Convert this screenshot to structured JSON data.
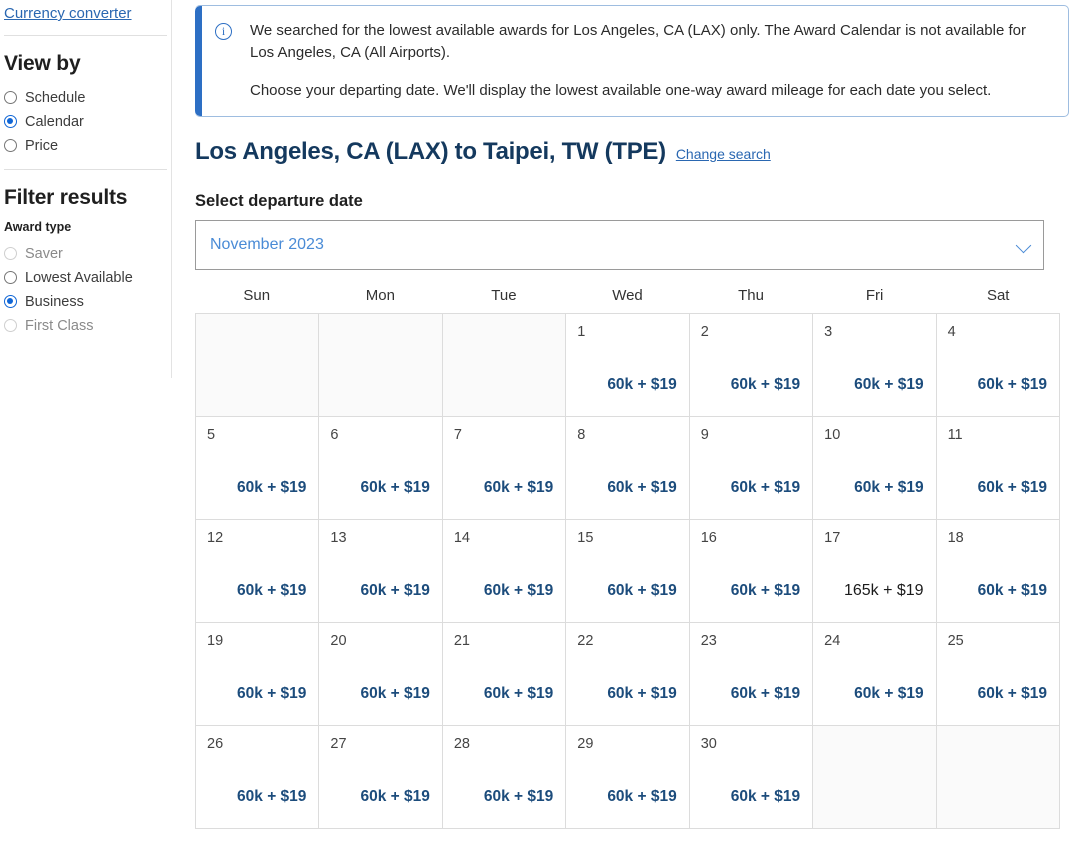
{
  "sidebar": {
    "currency_converter_label": "Currency converter",
    "view_by": {
      "heading": "View by",
      "options": [
        {
          "label": "Schedule",
          "checked": false,
          "disabled": false
        },
        {
          "label": "Calendar",
          "checked": true,
          "disabled": false
        },
        {
          "label": "Price",
          "checked": false,
          "disabled": false
        }
      ]
    },
    "filter_results": {
      "heading": "Filter results",
      "award_type_heading": "Award type",
      "options": [
        {
          "label": "Saver",
          "checked": false,
          "disabled": true
        },
        {
          "label": "Lowest Available",
          "checked": false,
          "disabled": false
        },
        {
          "label": "Business",
          "checked": true,
          "disabled": false
        },
        {
          "label": "First Class",
          "checked": false,
          "disabled": true
        }
      ]
    }
  },
  "banner": {
    "icon": "info-circle-icon",
    "paragraph_1": "We searched for the lowest available awards for Los Angeles, CA (LAX) only. The Award Calendar is not available for Los Angeles, CA (All Airports).",
    "paragraph_2": "Choose your departing date. We'll display the lowest available one-way award mileage for each date you select.",
    "accent_color": "#2d6fc4"
  },
  "route": {
    "title": "Los Angeles, CA (LAX) to Taipei, TW (TPE)",
    "change_search_label": "Change search",
    "title_color": "#14395e"
  },
  "departure": {
    "label": "Select departure date",
    "selected_month": "November 2023",
    "chevron_icon": "chevron-down-icon"
  },
  "calendar": {
    "weekdays": [
      "Sun",
      "Mon",
      "Tue",
      "Wed",
      "Thu",
      "Fri",
      "Sat"
    ],
    "available_color": "#1c4c7c",
    "selected_color": "#1b1b1b",
    "weeks": [
      [
        {
          "day": "",
          "price": ""
        },
        {
          "day": "",
          "price": ""
        },
        {
          "day": "",
          "price": ""
        },
        {
          "day": "1",
          "price": "60k + $19",
          "selected": false
        },
        {
          "day": "2",
          "price": "60k + $19",
          "selected": false
        },
        {
          "day": "3",
          "price": "60k + $19",
          "selected": false
        },
        {
          "day": "4",
          "price": "60k + $19",
          "selected": false
        }
      ],
      [
        {
          "day": "5",
          "price": "60k + $19",
          "selected": false
        },
        {
          "day": "6",
          "price": "60k + $19",
          "selected": false
        },
        {
          "day": "7",
          "price": "60k + $19",
          "selected": false
        },
        {
          "day": "8",
          "price": "60k + $19",
          "selected": false
        },
        {
          "day": "9",
          "price": "60k + $19",
          "selected": false
        },
        {
          "day": "10",
          "price": "60k + $19",
          "selected": false
        },
        {
          "day": "11",
          "price": "60k + $19",
          "selected": false
        }
      ],
      [
        {
          "day": "12",
          "price": "60k + $19",
          "selected": false
        },
        {
          "day": "13",
          "price": "60k + $19",
          "selected": false
        },
        {
          "day": "14",
          "price": "60k + $19",
          "selected": false
        },
        {
          "day": "15",
          "price": "60k + $19",
          "selected": false
        },
        {
          "day": "16",
          "price": "60k + $19",
          "selected": false
        },
        {
          "day": "17",
          "price": "165k + $19",
          "selected": true
        },
        {
          "day": "18",
          "price": "60k + $19",
          "selected": false
        }
      ],
      [
        {
          "day": "19",
          "price": "60k + $19",
          "selected": false
        },
        {
          "day": "20",
          "price": "60k + $19",
          "selected": false
        },
        {
          "day": "21",
          "price": "60k + $19",
          "selected": false
        },
        {
          "day": "22",
          "price": "60k + $19",
          "selected": false
        },
        {
          "day": "23",
          "price": "60k + $19",
          "selected": false
        },
        {
          "day": "24",
          "price": "60k + $19",
          "selected": false
        },
        {
          "day": "25",
          "price": "60k + $19",
          "selected": false
        }
      ],
      [
        {
          "day": "26",
          "price": "60k + $19",
          "selected": false
        },
        {
          "day": "27",
          "price": "60k + $19",
          "selected": false
        },
        {
          "day": "28",
          "price": "60k + $19",
          "selected": false
        },
        {
          "day": "29",
          "price": "60k + $19",
          "selected": false
        },
        {
          "day": "30",
          "price": "60k + $19",
          "selected": false
        },
        {
          "day": "",
          "price": ""
        },
        {
          "day": "",
          "price": ""
        }
      ]
    ]
  }
}
